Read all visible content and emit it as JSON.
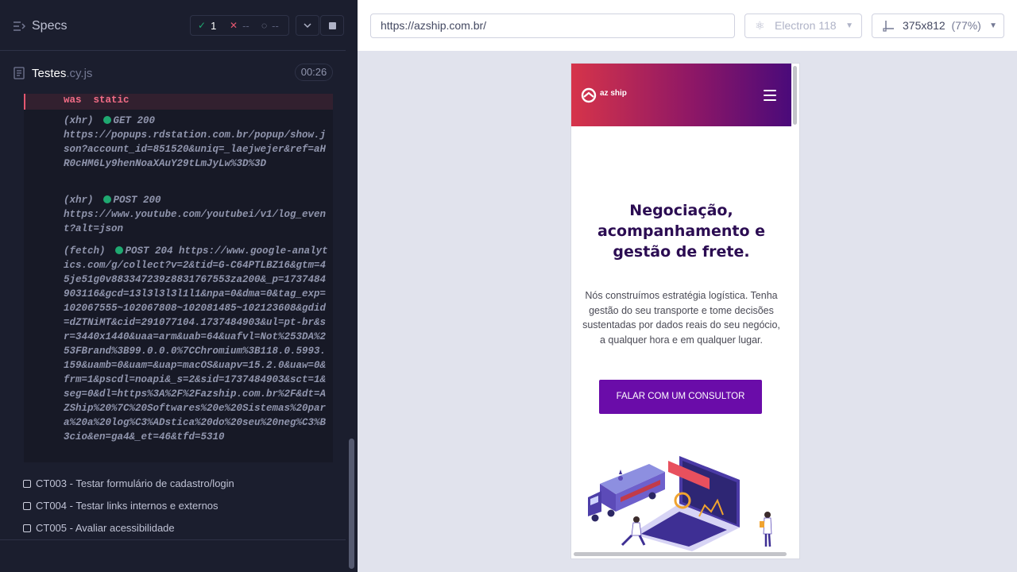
{
  "reporter": {
    "title": "Specs",
    "stats": {
      "passed": "1",
      "failed": "--",
      "pending": "--"
    },
    "spec_file": {
      "name": "Testes",
      "ext": ".cy.js",
      "duration": "00:26"
    },
    "log_static": "was  static",
    "logs": [
      {
        "prefix": "(xhr)",
        "method": "GET 200",
        "url": "https://popups.rdstation.com.br/popup/show.json?account_id=851520&uniq=_laejwejer&ref=aHR0cHM6Ly9henNoaXAuY29tLmJyLw%3D%3D"
      },
      {
        "prefix": "(xhr)",
        "method": "POST 200",
        "url": "https://www.youtube.com/youtubei/v1/log_event?alt=json"
      },
      {
        "prefix": "(fetch)",
        "method": "POST 204",
        "url": "https://www.google-analytics.com/g/collect?v=2&tid=G-C64PTLBZ16&gtm=45je51g0v883347239z8831767553za200&_p=1737484903116&gcd=13l3l3l3l1l1&npa=0&dma=0&tag_exp=102067555~102067808~102081485~102123608&gdid=dZTNiMT&cid=291077104.1737484903&ul=pt-br&sr=3440x1440&uaa=arm&uab=64&uafvl=Not%253DA%253FBrand%3B99.0.0.0%7CChromium%3B118.0.5993.159&uamb=0&uam=&uap=macOS&uapv=15.2.0&uaw=0&frm=1&pscdl=noapi&_s=2&sid=1737484903&sct=1&seg=0&dl=https%3A%2F%2Fazship.com.br%2F&dt=AZShip%20%7C%20Softwares%20e%20Sistemas%20para%20a%20log%C3%ADstica%20do%20seu%20neg%C3%B3cio&en=ga4&_et=46&tfd=5310"
      }
    ],
    "tests": [
      "CT003 - Testar formulário de cadastro/login",
      "CT004 - Testar links internos e externos",
      "CT005 - Avaliar acessibilidade"
    ]
  },
  "runner": {
    "url": "https://azship.com.br/",
    "browser": "Electron 118",
    "viewport": "375x812",
    "viewport_scale": "(77%)"
  },
  "site": {
    "logo_text": "az ship",
    "hero_title_lines": [
      "Negociação,",
      "acompanhamento e",
      "gestão de frete."
    ],
    "hero_text": "Nós construímos estratégia logística. Tenha gestão do seu transporte e tome decisões sustentadas por dados reais do seu negócio, a qualquer hora e em qualquer lugar.",
    "cta_label": "FALAR COM UM CONSULTOR"
  },
  "colors": {
    "pass": "#1fa971",
    "fail": "#e45770",
    "cta": "#6a0ca9",
    "hero_title": "#2b0c52"
  },
  "icons": [
    "specs-icon",
    "check-icon",
    "x-icon",
    "spinner-icon",
    "chevron-down-icon",
    "stop-icon",
    "file-icon",
    "electron-icon",
    "viewport-icon",
    "menu-icon",
    "checkbox-icon"
  ]
}
